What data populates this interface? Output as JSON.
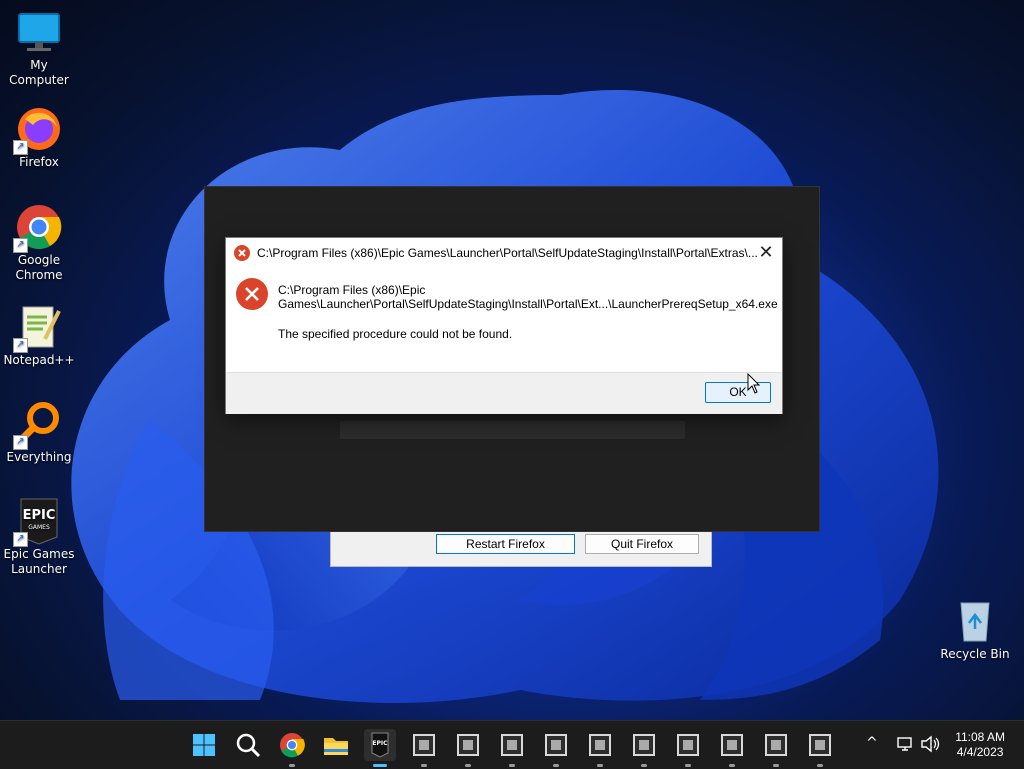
{
  "desktop": {
    "icons": [
      {
        "label": "My Computer",
        "icon": "monitor-icon"
      },
      {
        "label": "Firefox",
        "icon": "firefox-icon"
      },
      {
        "label": "Google Chrome",
        "icon": "chrome-icon"
      },
      {
        "label": "Notepad++",
        "icon": "notepadpp-icon"
      },
      {
        "label": "Everything",
        "icon": "magnifier-icon"
      },
      {
        "label": "Epic Games Launcher",
        "icon": "epic-games-icon"
      },
      {
        "label": "Recycle Bin",
        "icon": "recycle-bin-icon"
      }
    ]
  },
  "firefox_crash": {
    "restart_label": "Restart Firefox",
    "quit_label": "Quit Firefox"
  },
  "error_dialog": {
    "title": "C:\\Program Files (x86)\\Epic Games\\Launcher\\Portal\\SelfUpdateStaging\\Install\\Portal\\Extras\\...",
    "path_line1": "C:\\Program Files (x86)\\Epic",
    "path_line2": "Games\\Launcher\\Portal\\SelfUpdateStaging\\Install\\Portal\\Ext...\\LauncherPrereqSetup_x64.exe",
    "message": "The specified procedure could not be found.",
    "ok_label": "OK",
    "close_glyph": "✕",
    "error_glyph": "✕"
  },
  "taskbar": {
    "time": "11:08 AM",
    "date": "4/4/2023",
    "epic_label": "EPIC",
    "tray_chevron": "^"
  },
  "colors": {
    "accent": "#0078d7",
    "error_red": "#d9442b"
  }
}
